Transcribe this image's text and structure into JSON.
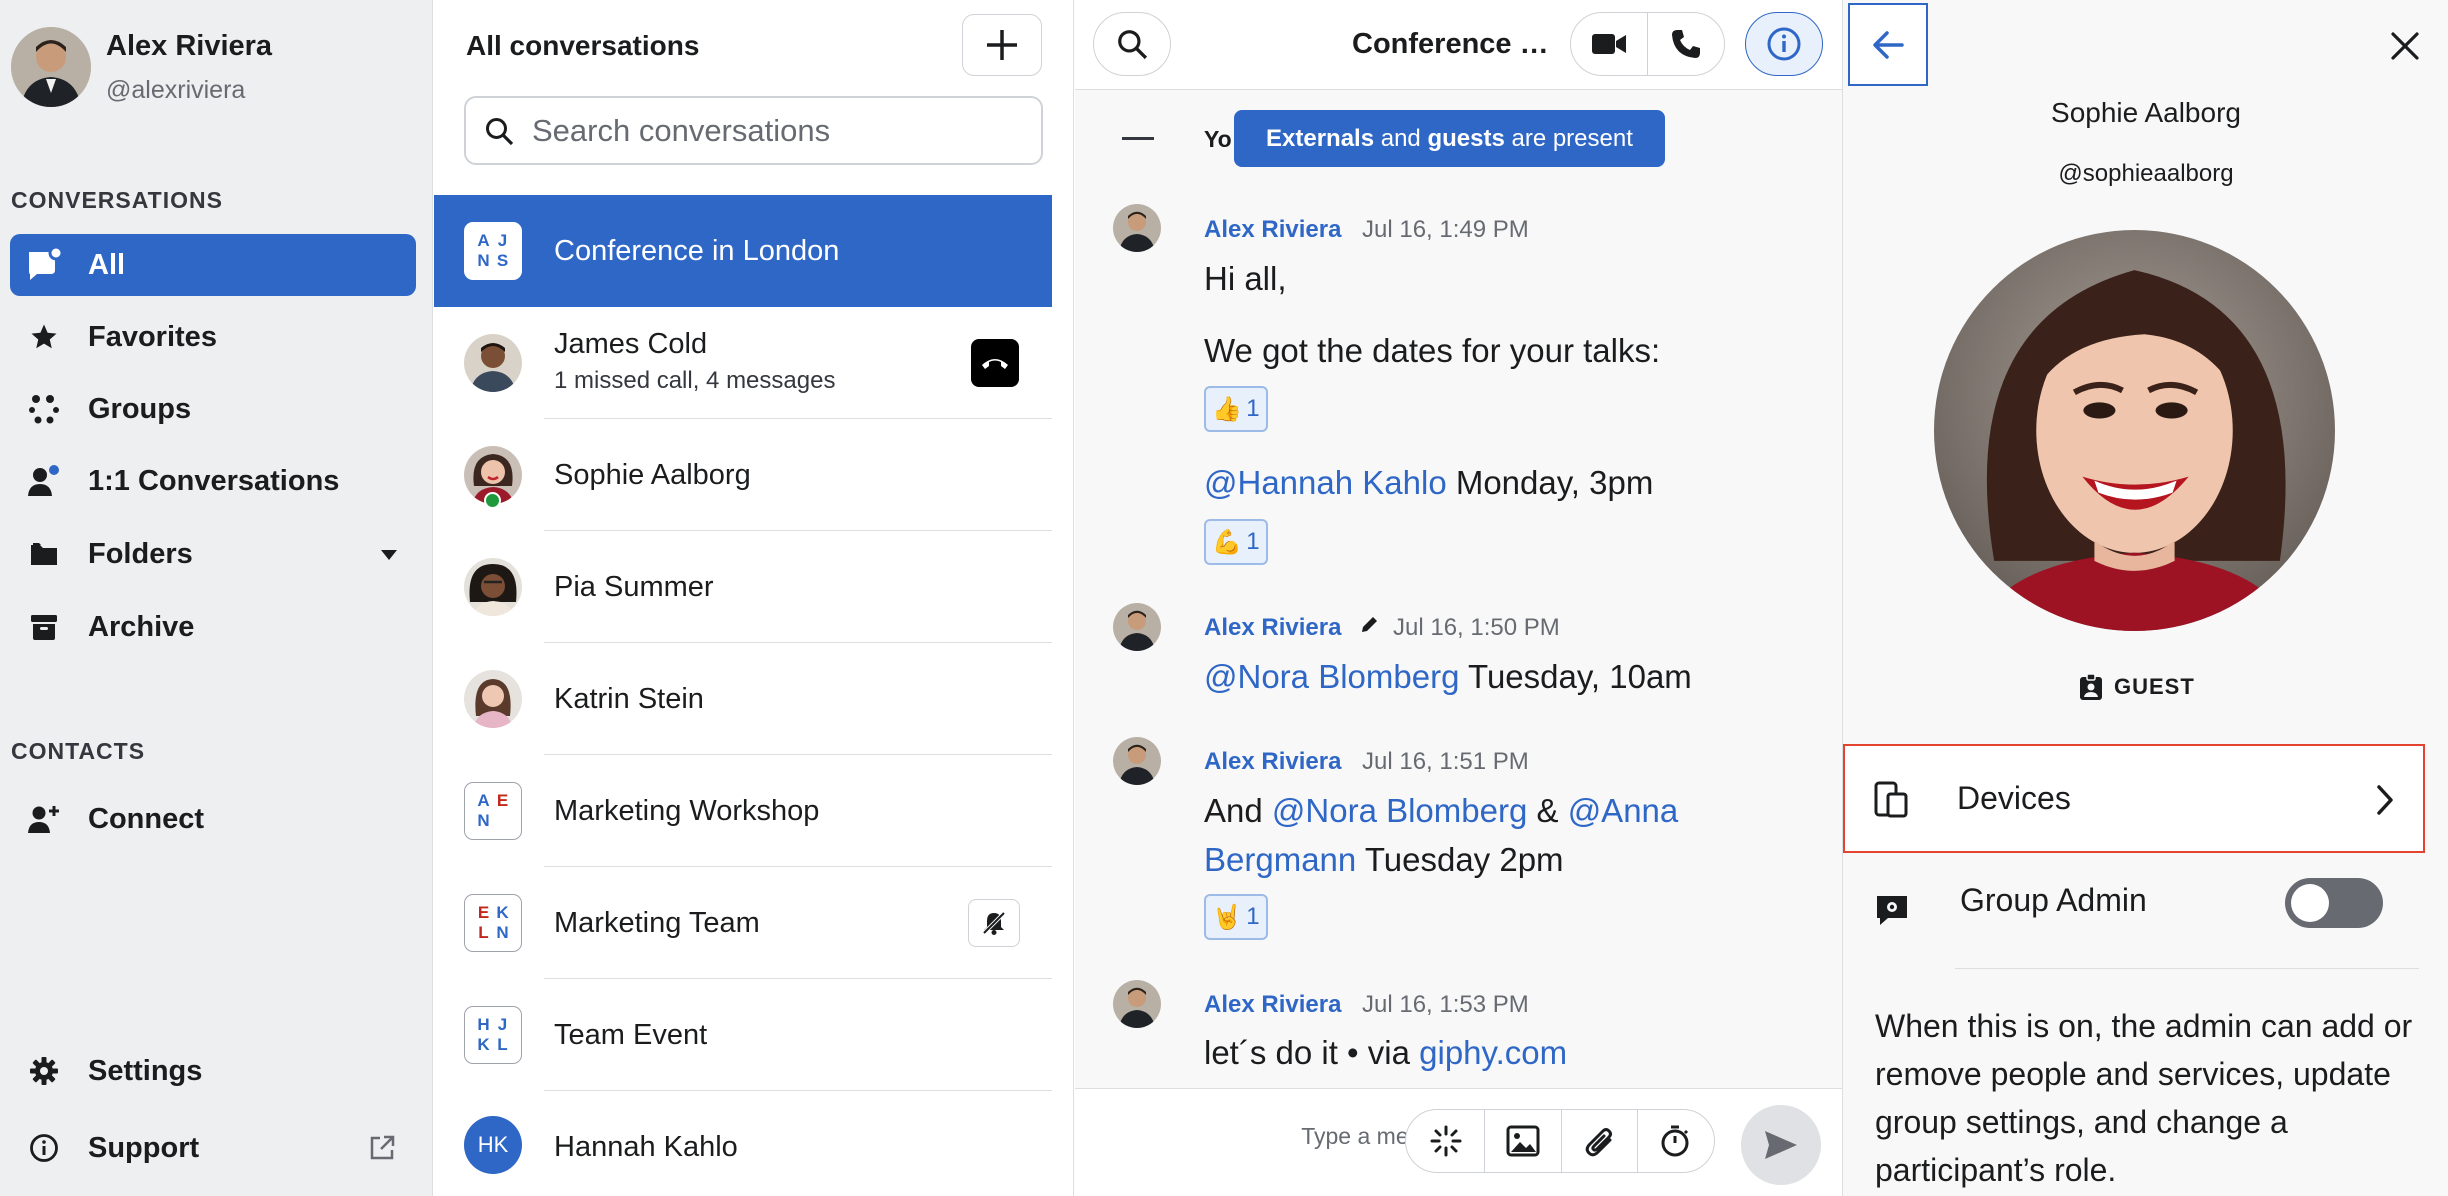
{
  "user": {
    "name": "Alex Riviera",
    "handle": "@alexriviera"
  },
  "sidebar": {
    "conversations_title": "CONVERSATIONS",
    "items": [
      {
        "label": "All",
        "icon": "chat-bubble-icon"
      },
      {
        "label": "Favorites",
        "icon": "star-icon"
      },
      {
        "label": "Groups",
        "icon": "groups-icon"
      },
      {
        "label": "1:1 Conversations",
        "icon": "person-icon"
      },
      {
        "label": "Folders",
        "icon": "folder-icon"
      },
      {
        "label": "Archive",
        "icon": "archive-icon"
      }
    ],
    "contacts_title": "CONTACTS",
    "connect_label": "Connect",
    "settings_label": "Settings",
    "support_label": "Support"
  },
  "list": {
    "title": "All conversations",
    "search_placeholder": "Search conversations",
    "conversations": [
      {
        "name": "Conference in London",
        "type": "group",
        "letters": [
          "A",
          "J",
          "N",
          "S"
        ]
      },
      {
        "name": "James Cold",
        "subtitle": "1 missed call, 4 messages",
        "type": "person"
      },
      {
        "name": "Sophie Aalborg",
        "type": "person"
      },
      {
        "name": "Pia Summer",
        "type": "person"
      },
      {
        "name": "Katrin Stein",
        "type": "person"
      },
      {
        "name": "Marketing Workshop",
        "type": "group",
        "letters": [
          "A",
          "E",
          "N",
          ""
        ]
      },
      {
        "name": "Marketing Team",
        "type": "group",
        "letters": [
          "E",
          "K",
          "L",
          "N"
        ]
      },
      {
        "name": "Team Event",
        "type": "group",
        "letters": [
          "H",
          "J",
          "K",
          "L"
        ]
      },
      {
        "name": "Hannah Kahlo",
        "type": "initials",
        "initials": "HK"
      }
    ]
  },
  "chat": {
    "title": "Conference in London",
    "notice_parts": [
      "Externals",
      " and ",
      "guests",
      " are present"
    ],
    "hidden_text": "Yo",
    "messages": [
      {
        "author": "Alex Riviera",
        "time": "Jul 16, 1:49 PM"
      },
      {
        "author": "Alex Riviera",
        "time": "Jul 16, 1:50 PM"
      },
      {
        "author": "Alex Riviera",
        "time": "Jul 16, 1:51 PM"
      },
      {
        "author": "Alex Riviera",
        "time": "Jul 16, 1:53 PM"
      }
    ],
    "m1_line1": "Hi all,",
    "m1_line2": "We got the dates for your talks:",
    "m1_reaction": "👍",
    "m1_reaction_count": "1",
    "m1_mention": "@Hannah Kahlo",
    "m1_line3_rest": " Monday, 3pm",
    "m1_reaction2": "💪",
    "m1_reaction2_count": "1",
    "m2_mention": "@Nora Blomberg",
    "m2_rest": " Tuesday, 10am",
    "m3_and": "And ",
    "m3_mention1": "@Nora Blomberg",
    "m3_amp": " & ",
    "m3_mention2a": "@Anna",
    "m3_mention2b": "Bergmann",
    "m3_rest": " Tuesday 2pm",
    "m3_reaction": "🤘",
    "m3_reaction_count": "1",
    "m4_text": "let´s do it • via ",
    "m4_link": "giphy.com",
    "composer_placeholder": "Type a message"
  },
  "panel": {
    "name": "Sophie Aalborg",
    "handle": "@sophieaalborg",
    "badge": "GUEST",
    "devices_label": "Devices",
    "group_admin_label": "Group Admin",
    "group_admin_on": false,
    "admin_description": "When this is on, the admin can add or remove people and services, update group settings, and change a participant’s role."
  },
  "colors": {
    "accent": "#2f67c6",
    "highlight_border": "#e2442f",
    "online": "#1e9a3c",
    "group_letters_blue": "#2f67c6",
    "group_letters_red": "#c2281b"
  }
}
